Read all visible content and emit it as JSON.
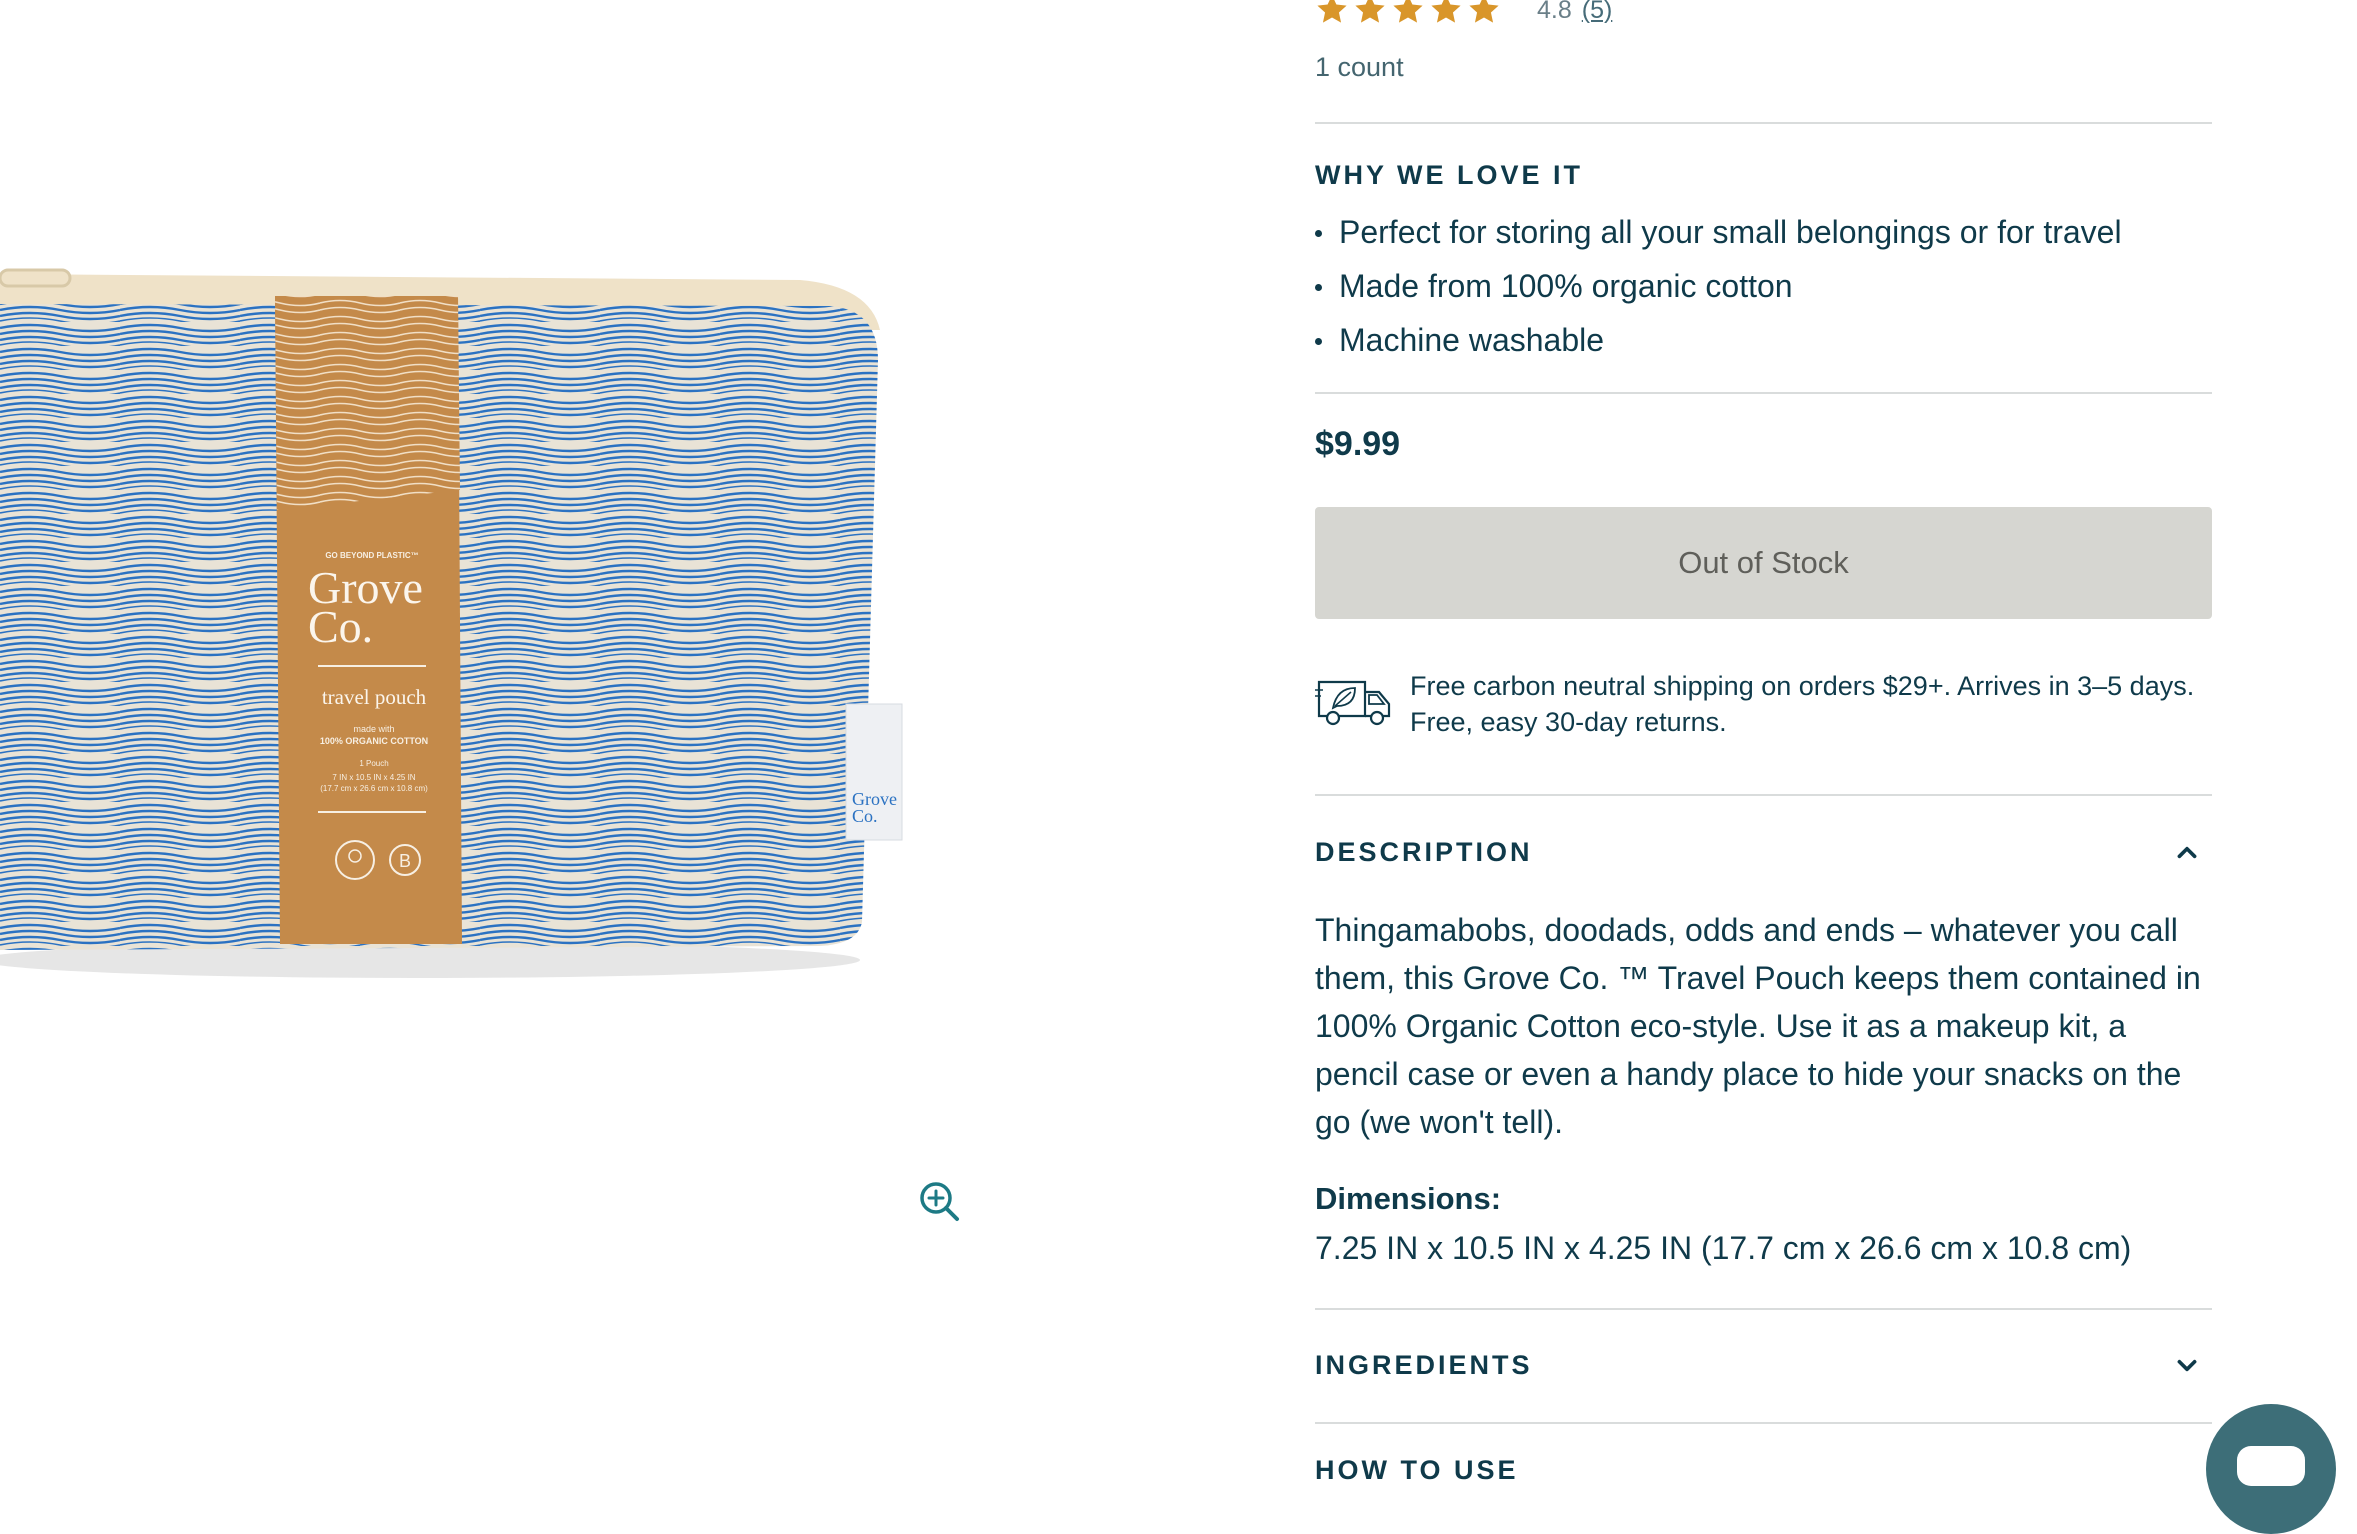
{
  "product": {
    "rating_value": "4.8",
    "review_count": "(5)",
    "rating_stars": 5,
    "count": "1 count",
    "why_heading": "WHY WE LOVE IT",
    "bullets": [
      "Perfect for storing all your small belongings or for travel",
      "Made from 100% organic cotton",
      "Machine washable"
    ],
    "price": "$9.99",
    "stock_button": "Out of Stock",
    "shipping_text": "Free carbon neutral shipping on orders $29+. Arrives in 3–5 days. Free, easy 30-day returns."
  },
  "package_label": {
    "tagline": "GO BEYOND PLASTIC™",
    "brand_line1": "Grove",
    "brand_line2": "Co.",
    "product_name": "travel pouch",
    "made_with_1": "made with",
    "made_with_2": "100% ORGANIC COTTON",
    "qty": "1 Pouch",
    "size_1": "7 IN x 10.5 IN x 4.25 IN",
    "size_2": "(17.7 cm x 26.6 cm x 10.8 cm)",
    "tag_brand_1": "Grove",
    "tag_brand_2": "Co."
  },
  "accordion": {
    "description_title": "DESCRIPTION",
    "description_text": "Thingamabobs, doodads, odds and ends – whatever you call them, this Grove Co. ™ Travel Pouch keeps them contained in 100% Organic Cotton eco-style. Use it as a makeup kit, a pencil case or even a handy place to hide your snacks on the go (we won't tell).",
    "dimensions_label": "Dimensions:",
    "dimensions_value": "7.25 IN x 10.5 IN x 4.25 IN (17.7 cm x 26.6 cm x 10.8 cm)",
    "ingredients_title": "INGREDIENTS",
    "how_to_use_title": "HOW TO USE"
  },
  "colors": {
    "text": "#0f3a4a",
    "star": "#d9962a",
    "button_disabled": "#d6d6d1",
    "zoom_icon": "#1d7a85",
    "chat": "#3d6e78",
    "pouch_blue": "#2b72c2",
    "label_kraft": "#c48a4a"
  },
  "icons": [
    "star-icon",
    "zoom-in-icon",
    "delivery-truck-icon",
    "chevron-up-icon",
    "chevron-down-icon",
    "chat-icon"
  ]
}
